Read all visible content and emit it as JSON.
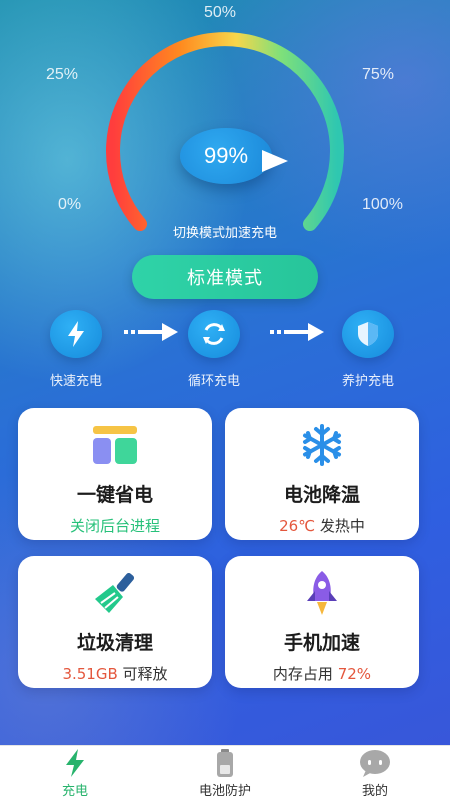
{
  "gauge": {
    "ticks": [
      "0%",
      "25%",
      "50%",
      "75%",
      "100%"
    ],
    "percent_text": "99%",
    "switch_hint": "切换模式加速充电"
  },
  "mode_button": {
    "label": "标准模式"
  },
  "stages": [
    {
      "label": "快速充电",
      "icon": "lightning-icon"
    },
    {
      "label": "循环充电",
      "icon": "cycle-icon"
    },
    {
      "label": "养护充电",
      "icon": "shield-icon"
    }
  ],
  "cards": {
    "power_save": {
      "title": "一键省电",
      "sub": "关闭后台进程",
      "icon": "app-grid-icon",
      "accent": "#27c17a"
    },
    "battery_cool": {
      "title": "电池降温",
      "temp": "26℃",
      "sub": "发热中",
      "icon": "snowflake-icon",
      "accent": "#e4573d"
    },
    "junk_clean": {
      "title": "垃圾清理",
      "size": "3.51GB",
      "sub": "可释放",
      "icon": "broom-icon",
      "accent": "#e4573d"
    },
    "phone_boost": {
      "title": "手机加速",
      "prefix": "内存占用",
      "usage": "72%",
      "icon": "rocket-icon",
      "accent": "#e4573d"
    }
  },
  "tabbar": {
    "tabs": [
      {
        "label": "充电",
        "icon": "charge-icon",
        "active": true
      },
      {
        "label": "电池防护",
        "icon": "battery-icon",
        "active": false
      },
      {
        "label": "我的",
        "icon": "chat-face-icon",
        "active": false
      }
    ]
  },
  "colors": {
    "accent_green": "#27c17a",
    "warn_red": "#e4573d",
    "bubble_blue": "#1a86d8"
  }
}
